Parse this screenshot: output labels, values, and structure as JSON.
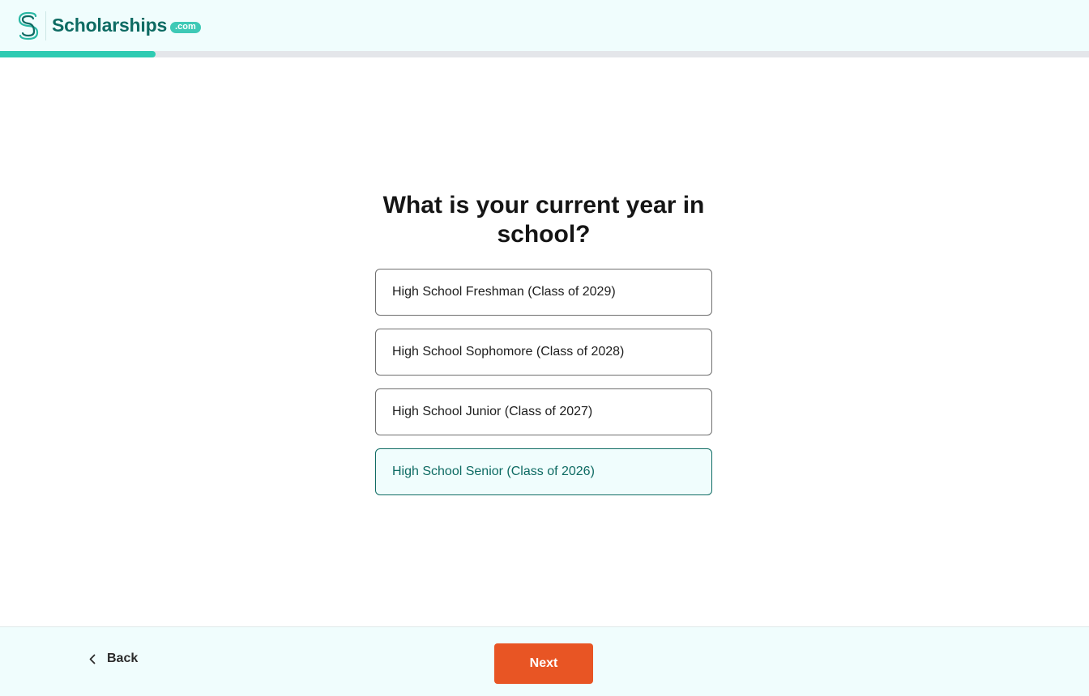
{
  "brand": {
    "name": "Scholarships",
    "suffix": ".com",
    "colors": {
      "primary": "#0e6b63",
      "accent": "#3ec9b6",
      "cta": "#e85524"
    }
  },
  "progress": {
    "fraction": 0.143
  },
  "question": {
    "title": "What is your current year in school?"
  },
  "options": [
    {
      "label": "High School Freshman (Class of 2029)",
      "selected": false
    },
    {
      "label": "High School Sophomore (Class of 2028)",
      "selected": false
    },
    {
      "label": "High School Junior (Class of 2027)",
      "selected": false
    },
    {
      "label": "High School Senior (Class of 2026)",
      "selected": true
    }
  ],
  "footer": {
    "back_label": "Back",
    "back_icon": "chevron-left-icon",
    "next_label": "Next"
  }
}
